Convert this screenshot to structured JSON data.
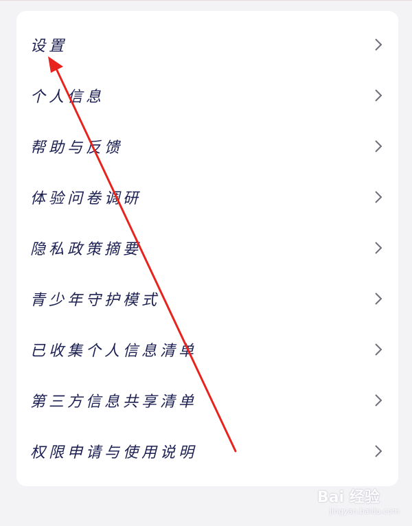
{
  "menu": {
    "items": [
      {
        "label": "设置"
      },
      {
        "label": "个人信息"
      },
      {
        "label": "帮助与反馈"
      },
      {
        "label": "体验问卷调研"
      },
      {
        "label": "隐私政策摘要"
      },
      {
        "label": "青少年守护模式"
      },
      {
        "label": "已收集个人信息清单"
      },
      {
        "label": "第三方信息共享清单"
      },
      {
        "label": "权限申请与使用说明"
      }
    ],
    "chevron_icon": "chevron-right-icon"
  },
  "annotation": {
    "arrow_color": "#e8231d",
    "target_item": "设置"
  },
  "watermark": {
    "logo_text": "Bai 经验",
    "url_text": "jingyan.baidu.com"
  },
  "colors": {
    "background": "#f3f3f5",
    "card": "#ffffff",
    "label": "#1c1f52",
    "chevron": "#6e6e78"
  }
}
